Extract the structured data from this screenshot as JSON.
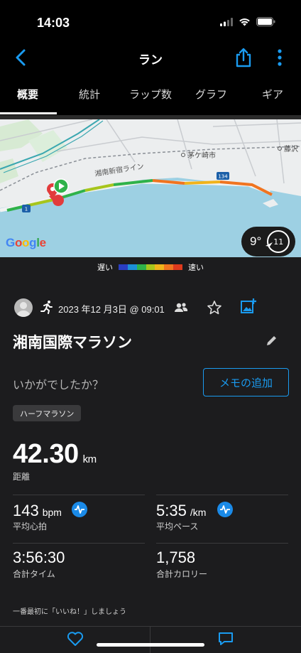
{
  "status_bar": {
    "time": "14:03"
  },
  "nav": {
    "title": "ラン"
  },
  "tabs": [
    "概要",
    "統計",
    "ラップ数",
    "グラフ",
    "ギア"
  ],
  "map": {
    "labels": {
      "route_line": "湘南新宿ライン",
      "city": "茅ケ崎市",
      "city2": "藤沢",
      "road_134": "134",
      "road_1": "1"
    },
    "google": "Google",
    "weather": {
      "temperature": "9°",
      "wind": "11"
    }
  },
  "legend": {
    "slow": "遅い",
    "fast": "速い",
    "colors": [
      "#2a3ec2",
      "#1c8fd8",
      "#2fb24a",
      "#a7c51c",
      "#f0b31b",
      "#f07420",
      "#de3a1d"
    ]
  },
  "activity": {
    "date": "2023 年12 月3日 @ 09:01",
    "name": "湘南国際マラソン",
    "prompt": "いかがでしたか？",
    "memo_button": "メモの追加",
    "tag": "ハーフマラソン"
  },
  "stats": {
    "distance": {
      "value": "42.30",
      "unit": "km",
      "label": "距離"
    },
    "heart_rate": {
      "value": "143",
      "unit": "bpm",
      "label": "平均心拍"
    },
    "pace": {
      "value": "5:35",
      "unit": "/km",
      "label": "平均ペース"
    },
    "time": {
      "value": "3:56:30",
      "label": "合計タイム"
    },
    "calories": {
      "value": "1,758",
      "label": "合計カロリー"
    }
  },
  "social": {
    "prompt": "一番最初に「いいね！」しましょう"
  },
  "colors": {
    "accent": "#1a9bf0",
    "background": "#1c1c1e"
  }
}
